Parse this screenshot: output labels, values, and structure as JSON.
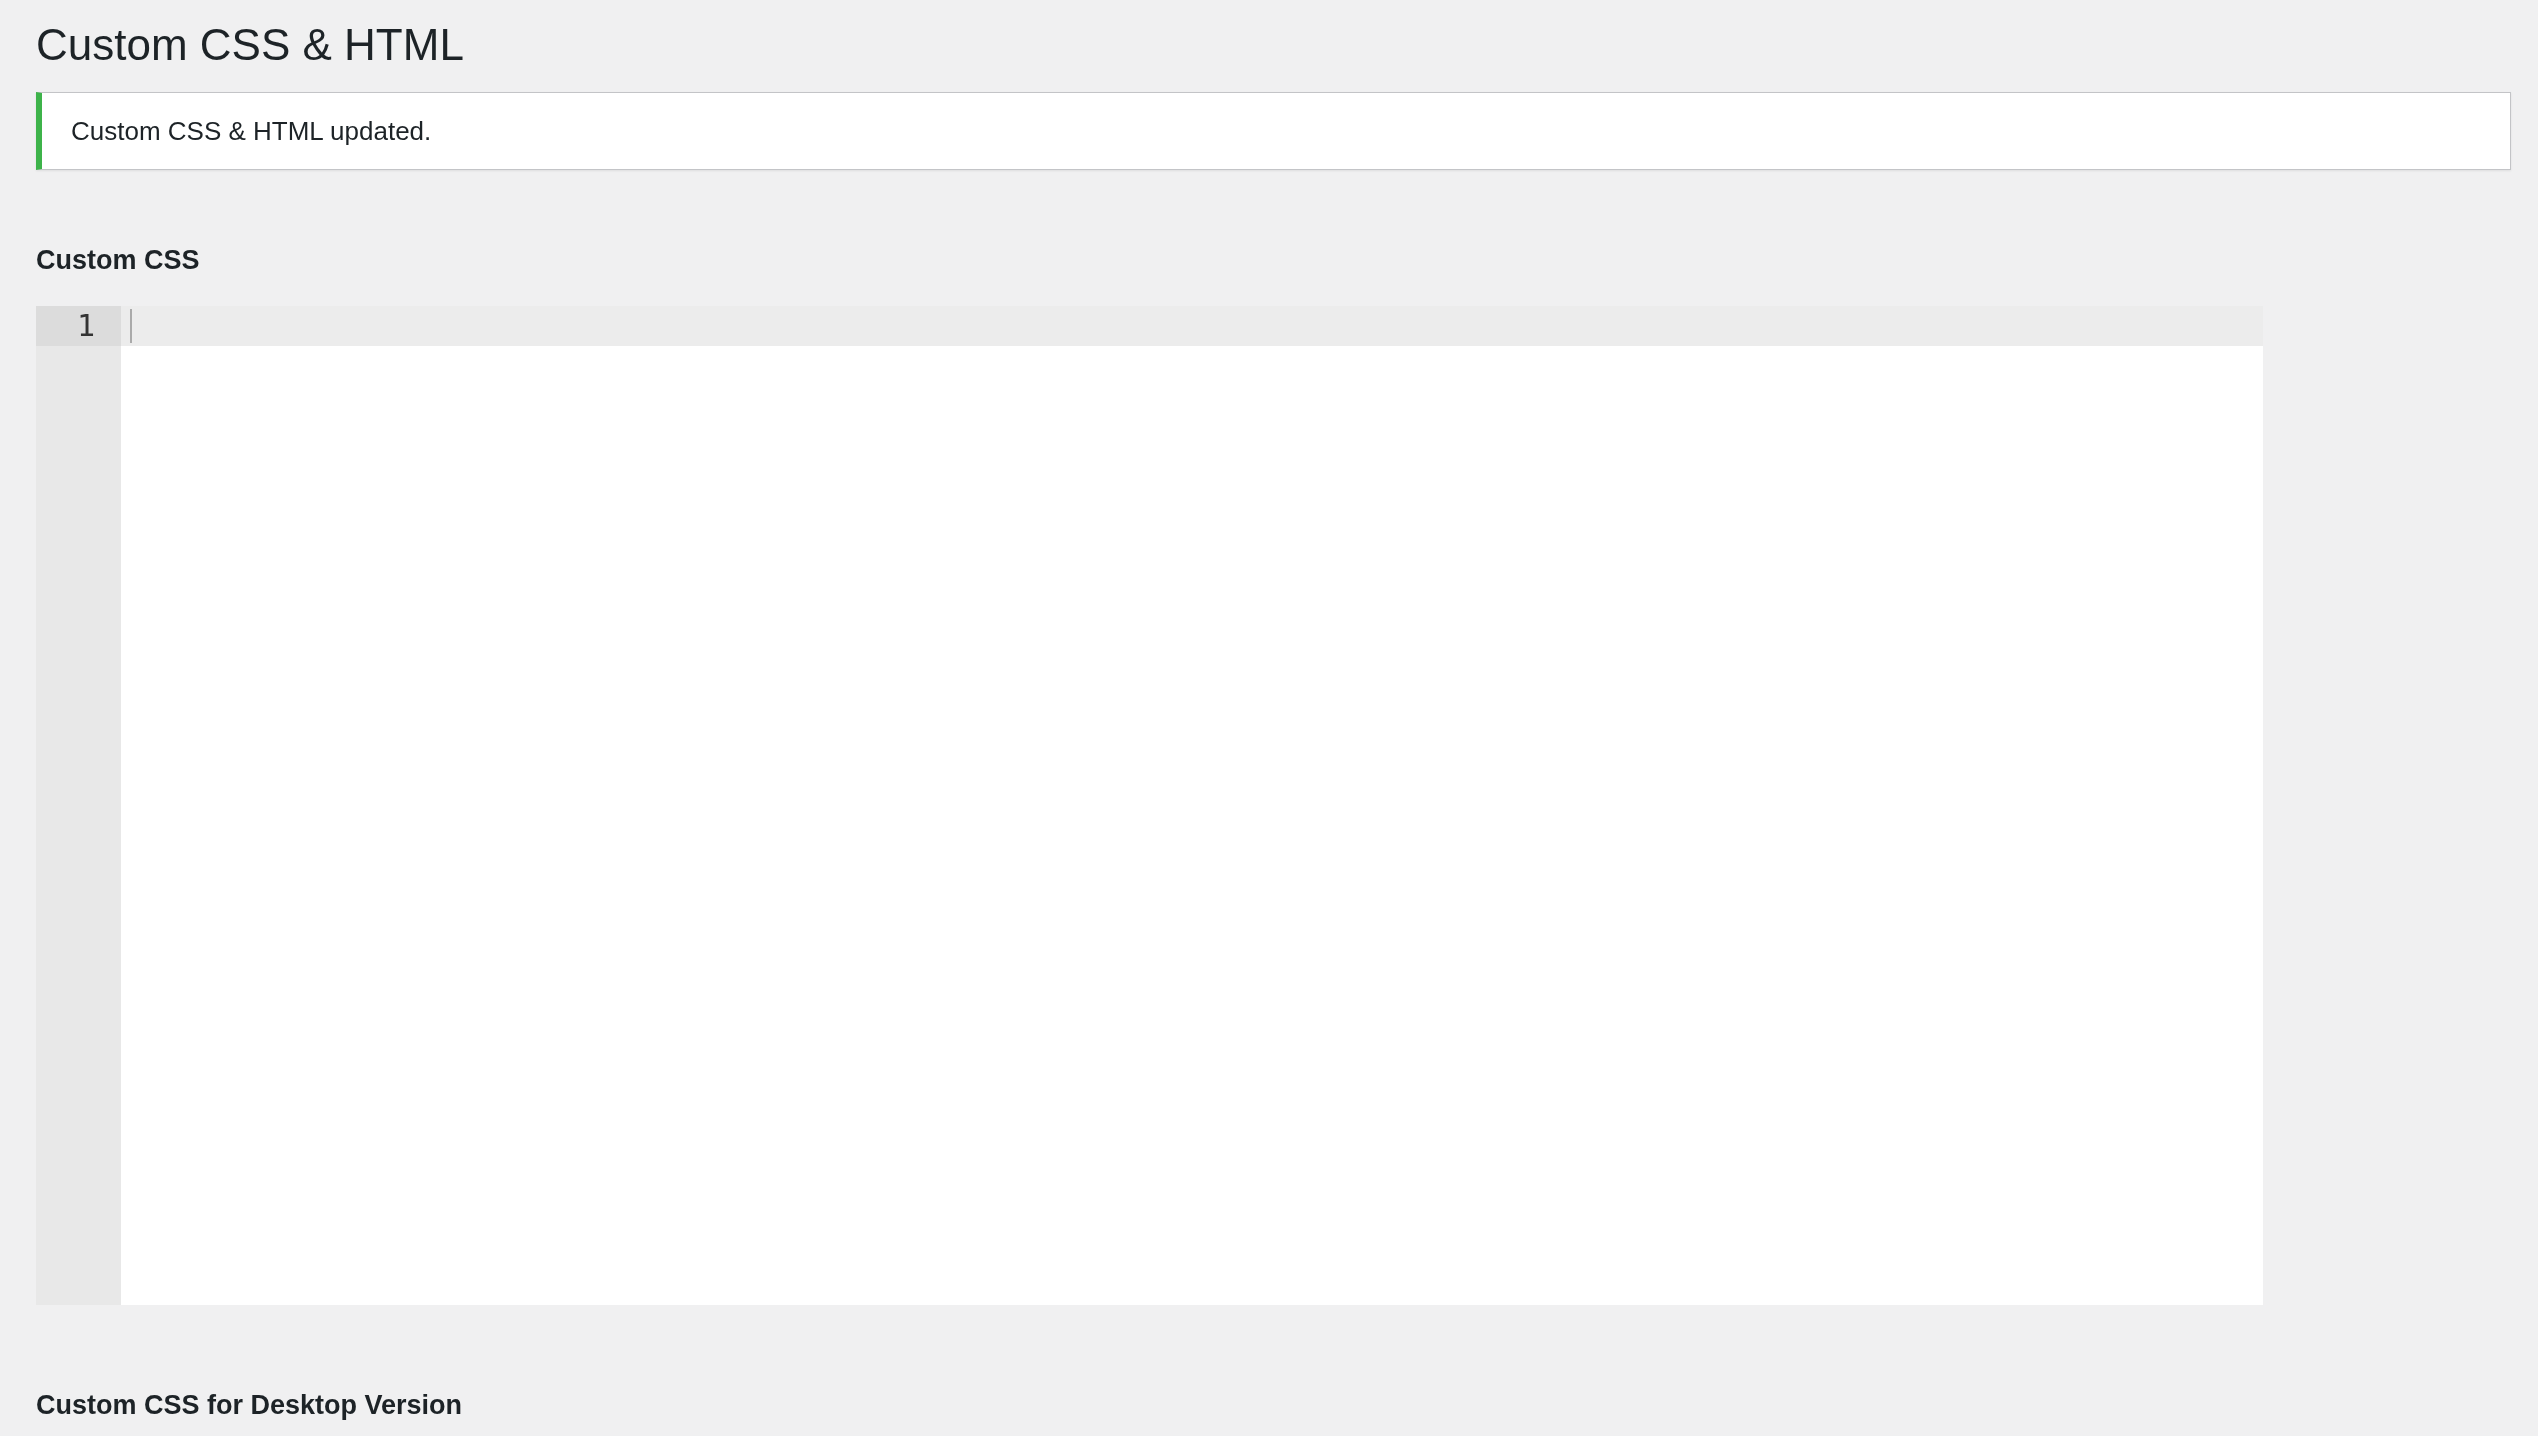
{
  "page": {
    "title": "Custom CSS & HTML"
  },
  "notice": {
    "message": "Custom CSS & HTML updated.",
    "success": true
  },
  "sections": [
    {
      "label": "Custom CSS",
      "editor": {
        "lines": [
          {
            "number": "1",
            "active": true
          }
        ]
      }
    },
    {
      "label": "Custom CSS for Desktop Version"
    }
  ]
}
